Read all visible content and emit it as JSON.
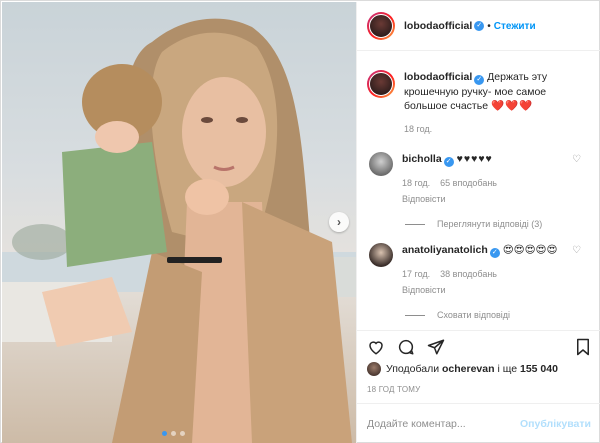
{
  "post": {
    "username": "lobodaofficial",
    "follow_label": "Стежити",
    "caption": "Держать эту крошечную ручку- мое самое большое счастье",
    "caption_emoji": "❤️❤️❤️",
    "caption_time": "18 год."
  },
  "comments": [
    {
      "username": "bicholla",
      "text": "♥♥♥♥♥",
      "time": "18 год.",
      "likes": "65 вподобань",
      "reply_label": "Відповісти",
      "thread_label": "Переглянути відповіді (3)"
    },
    {
      "username": "anatoliyanatolich",
      "text": "😍😍😍😍😍",
      "time": "17 год.",
      "likes": "38 вподобань",
      "reply_label": "Відповісти",
      "thread_label": "Сховати відповіді"
    }
  ],
  "likes_line": {
    "prefix": "Уподобали",
    "user": "ocherevan",
    "connector": "і ще",
    "count": "155 040"
  },
  "time_ago": "18 ГОД ТОМУ",
  "add_comment": {
    "placeholder": "Додайте коментар...",
    "publish_label": "Опублікувати"
  },
  "colors": {
    "accent": "#0095f6",
    "heart": "#e0245e",
    "verified": "#3897f0"
  }
}
